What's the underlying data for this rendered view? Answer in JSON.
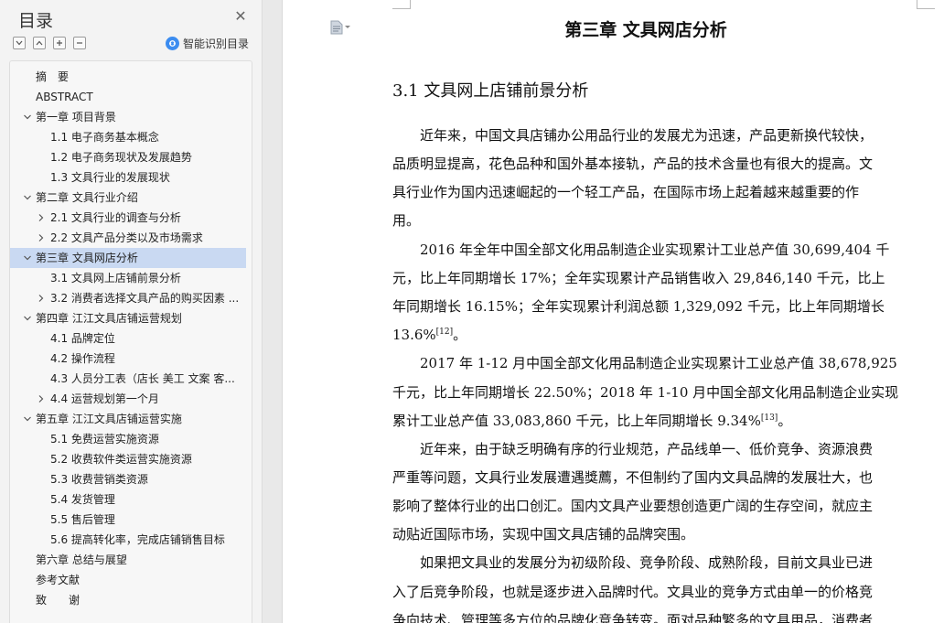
{
  "sidebar": {
    "title": "目录",
    "smart_label": "智能识别目录",
    "items": [
      {
        "label": "摘　要",
        "level": 0,
        "caret": ""
      },
      {
        "label": "ABSTRACT",
        "level": 0,
        "caret": ""
      },
      {
        "label": "第一章  项目背景",
        "level": 0,
        "caret": "down"
      },
      {
        "label": "1.1 电子商务基本概念",
        "level": 1,
        "caret": ""
      },
      {
        "label": "1.2 电子商务现状及发展趋势",
        "level": 1,
        "caret": ""
      },
      {
        "label": "1.3 文具行业的发展现状",
        "level": 1,
        "caret": ""
      },
      {
        "label": "第二章  文具行业介绍",
        "level": 0,
        "caret": "down"
      },
      {
        "label": "2.1 文具行业的调查与分析",
        "level": 1,
        "caret": "right"
      },
      {
        "label": "2.2 文具产品分类以及市场需求",
        "level": 1,
        "caret": "right"
      },
      {
        "label": "第三章  文具网店分析",
        "level": 0,
        "caret": "down",
        "active": true
      },
      {
        "label": "3.1 文具网上店铺前景分析",
        "level": 1,
        "caret": ""
      },
      {
        "label": "3.2 消费者选择文具产品的购买因素 ...",
        "level": 1,
        "caret": "right"
      },
      {
        "label": "第四章  江江文具店铺运营规划",
        "level": 0,
        "caret": "down"
      },
      {
        "label": "4.1 品牌定位",
        "level": 1,
        "caret": ""
      },
      {
        "label": "4.2 操作流程",
        "level": 1,
        "caret": ""
      },
      {
        "label": "4.3 人员分工表（店长  美工  文案  客...",
        "level": 1,
        "caret": ""
      },
      {
        "label": "4.4 运营规划第一个月",
        "level": 1,
        "caret": "right"
      },
      {
        "label": "第五章  江江文具店铺运营实施",
        "level": 0,
        "caret": "down"
      },
      {
        "label": "5.1 免费运营实施资源",
        "level": 1,
        "caret": ""
      },
      {
        "label": "5.2 收费软件类运营实施资源",
        "level": 1,
        "caret": ""
      },
      {
        "label": "5.3 收费营销类资源",
        "level": 1,
        "caret": ""
      },
      {
        "label": "5.4 发货管理",
        "level": 1,
        "caret": ""
      },
      {
        "label": "5.5 售后管理",
        "level": 1,
        "caret": ""
      },
      {
        "label": "5.6 提高转化率，完成店铺销售目标",
        "level": 1,
        "caret": ""
      },
      {
        "label": "第六章  总结与展望",
        "level": 0,
        "caret": ""
      },
      {
        "label": "参考文献",
        "level": 0,
        "caret": ""
      },
      {
        "label": "致　　谢",
        "level": 0,
        "caret": ""
      }
    ]
  },
  "document": {
    "chapter_title": "第三章  文具网店分析",
    "section_title": "3.1 文具网上店铺前景分析",
    "lines": [
      {
        "t": "近年来，中国文具店铺办公用品行业的发展尤为迅速，产品更新换代较快，",
        "indent": true
      },
      {
        "t": "品质明显提高，花色品种和国外基本接轨，产品的技术含量也有很大的提高。文"
      },
      {
        "t": "具行业作为国内迅速崛起的一个轻工产品，在国际市场上起着越来越重要的作"
      },
      {
        "t": "用。"
      },
      {
        "t": "2016 年全年中国全部文化用品制造企业实现累计工业总产值 30,699,404 千",
        "indent": true
      },
      {
        "t": "元，比上年同期增长 17%；全年实现累计产品销售收入 29,846,140 千元，比上"
      },
      {
        "t": "年同期增长 16.15%；全年实现累计利润总额 1,329,092 千元，比上年同期增长"
      },
      {
        "t": "13.6%",
        "sup": "[12]",
        "after": "。"
      },
      {
        "t": "2017 年 1-12 月中国全部文化用品制造企业实现累计工业总产值 38,678,925",
        "indent": true
      },
      {
        "t": "千元，比上年同期增长 22.50%；2018 年 1-10 月中国全部文化用品制造企业实现"
      },
      {
        "t": "累计工业总产值 33,083,860 千元，比上年同期增长 9.34%",
        "sup": "[13]",
        "after": "。"
      },
      {
        "t": "近年来，由于缺乏明确有序的行业规范，产品线单一、低价竞争、资源浪费",
        "indent": true
      },
      {
        "t": "严重等问题，文具行业发展遭遇獎薦，不但制约了国内文具品牌的发展壮大，也"
      },
      {
        "t": "影响了整体行业的出口创汇。国内文具产业要想创造更广阔的生存空间，就应主"
      },
      {
        "t": "动贴近国际市场，实现中国文具店铺的品牌突围。"
      },
      {
        "t": "如果把文具业的发展分为初级阶段、竞争阶段、成熟阶段，目前文具业已进",
        "indent": true
      },
      {
        "t": "入了后竞争阶段，也就是逐步进入品牌时代。文具业的竞争方式由单一的价格竞"
      },
      {
        "t": "争向技术、管理等多方位的品牌化竞争转变。面对品种繁多的文具用品，消费者"
      }
    ]
  }
}
